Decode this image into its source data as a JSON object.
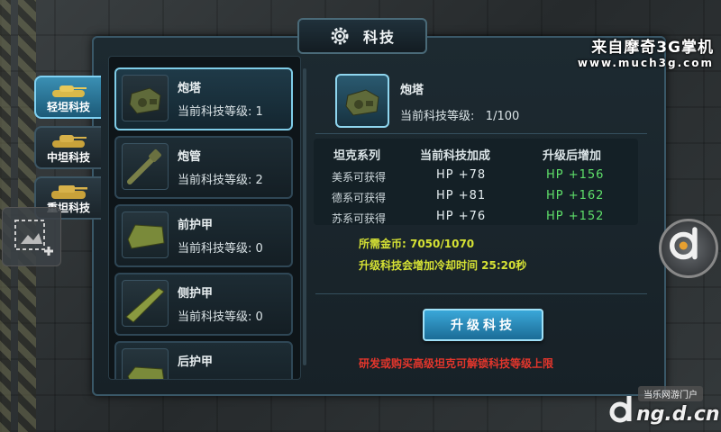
{
  "title": "科技",
  "watermark": {
    "line1": "来自摩奇3G掌机",
    "line2": "www.much3g.com"
  },
  "tank_tabs": [
    {
      "label": "轻坦科技",
      "active": true
    },
    {
      "label": "中坦科技",
      "active": false
    },
    {
      "label": "重坦科技",
      "active": false
    }
  ],
  "tech_items": [
    {
      "name": "炮塔",
      "level_label": "当前科技等级:",
      "level": "1",
      "icon": "turret-icon"
    },
    {
      "name": "炮管",
      "level_label": "当前科技等级:",
      "level": "2",
      "icon": "barrel-icon"
    },
    {
      "name": "前护甲",
      "level_label": "当前科技等级:",
      "level": "0",
      "icon": "front-armor-icon"
    },
    {
      "name": "侧护甲",
      "level_label": "当前科技等级:",
      "level": "0",
      "icon": "side-armor-icon"
    },
    {
      "name": "后护甲",
      "icon": "rear-armor-icon"
    }
  ],
  "detail": {
    "name": "炮塔",
    "level_label": "当前科技等级:",
    "level": "1/100",
    "headers": {
      "series": "坦克系列",
      "current": "当前科技加成",
      "next": "升级后增加"
    },
    "rows": [
      {
        "series": "美系可获得",
        "current": "HP +78",
        "next": "HP +156"
      },
      {
        "series": "德系可获得",
        "current": "HP +81",
        "next": "HP +162"
      },
      {
        "series": "苏系可获得",
        "current": "HP +76",
        "next": "HP +152"
      }
    ],
    "gold": "所需金币: 7050/1070",
    "cooldown": "升级科技会增加冷却时间 25:20秒",
    "upgrade_label": "升级科技",
    "notice": "研发或购买高级坦克可解锁科技等级上限"
  },
  "brand": {
    "badge": "当乐网游门户",
    "url": "ng.d.cn"
  },
  "colors": {
    "accent": "#7fd1f3",
    "highlight": "#5fe06a",
    "gold": "#d6e234",
    "warning": "#e3362c"
  }
}
